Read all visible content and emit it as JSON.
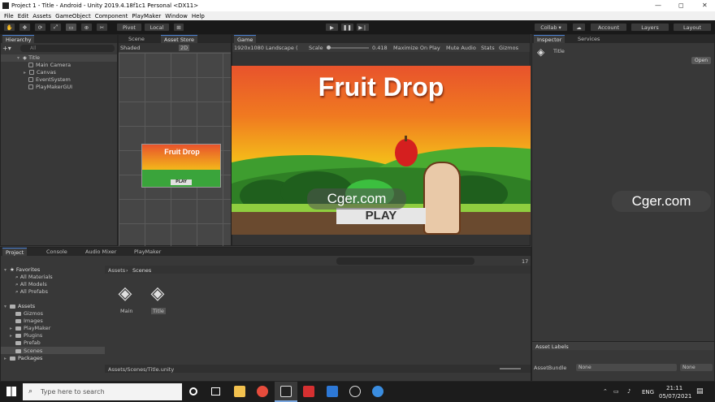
{
  "titlebar": {
    "title": "Project 1 - Title - Android - Unity 2019.4.18f1c1 Personal <DX11>",
    "minimize": "—",
    "maximize": "◻",
    "close": "✕"
  },
  "menu": [
    "File",
    "Edit",
    "Assets",
    "GameObject",
    "Component",
    "PlayMaker",
    "Window",
    "Help"
  ],
  "toolbar": {
    "pivot": "Pivot",
    "local": "Local",
    "collab": "Collab ▾",
    "account": "Account",
    "layers": "Layers",
    "layout": "Layout"
  },
  "hierarchy": {
    "tab": "Hierarchy",
    "search_placeholder": "All",
    "scene": "Title",
    "items": [
      "Main Camera",
      "Canvas",
      "EventSystem",
      "PlayMakerGUI"
    ]
  },
  "scene_tabs": {
    "scene": "Scene",
    "asset_store": "Asset Store",
    "shading": "Shaded",
    "mode_2d": "2D"
  },
  "game": {
    "tab": "Game",
    "resolution": "1920x1080 Landscape (",
    "scale_label": "Scale",
    "scale_value": "0.418",
    "maximize": "Maximize On Play",
    "mute": "Mute Audio",
    "stats": "Stats",
    "gizmos": "Gizmos",
    "title": "Fruit Drop",
    "play": "PLAY",
    "watermark": "Cger.com"
  },
  "scene_preview": {
    "title": "Fruit Drop",
    "play": "PLAY"
  },
  "inspector": {
    "tab": "Inspector",
    "services": "Services",
    "object": "Title",
    "open": "Open",
    "asset_labels": "Asset Labels",
    "asset_bundle": "AssetBundle",
    "bundle_value": "None",
    "variant_value": "None"
  },
  "watermark2": "Cger.com",
  "project": {
    "tabs": [
      "Project",
      "Console",
      "Audio Mixer",
      "PlayMaker"
    ],
    "favorites_label": "Favorites",
    "favorites": [
      "All Materials",
      "All Models",
      "All Prefabs"
    ],
    "assets_label": "Assets",
    "asset_folders": [
      "Gizmos",
      "Images",
      "PlayMaker",
      "Plugins",
      "Prefab",
      "Scenes"
    ],
    "packages": "Packages",
    "breadcrumb": [
      "Assets",
      "Scenes"
    ],
    "files": [
      "Main",
      "Title"
    ],
    "path": "Assets/Scenes/Title.unity",
    "count": "17"
  },
  "taskbar": {
    "search_placeholder": "Type here to search",
    "lang": "ENG",
    "time": "21:11",
    "date": "05/07/2021"
  },
  "colors": {
    "sky_top": "#e8532c",
    "sky_bottom": "#dde21e",
    "grass": "#3aa43b",
    "accent_blue": "#4a7fd0"
  }
}
